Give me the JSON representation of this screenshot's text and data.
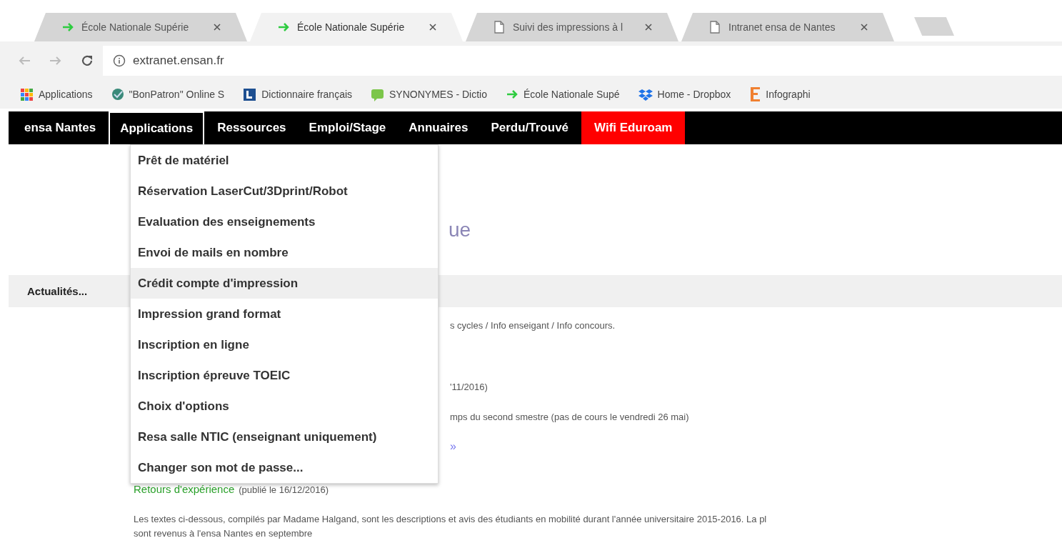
{
  "browser": {
    "tabs": [
      {
        "title": "École Nationale Supérie",
        "kind": "arrow",
        "selected": false
      },
      {
        "title": "École Nationale Supérie",
        "kind": "arrow",
        "selected": true
      },
      {
        "title": "Suivi des impressions à l",
        "kind": "page",
        "selected": false
      },
      {
        "title": "Intranet ensa de Nantes",
        "kind": "page",
        "selected": false
      }
    ],
    "address": "extranet.ensan.fr",
    "bookmarks": [
      {
        "label": "Applications",
        "kind": "grid"
      },
      {
        "label": "\"BonPatron\" Online S",
        "kind": "globe"
      },
      {
        "label": "Dictionnaire français",
        "kind": "book"
      },
      {
        "label": "SYNONYMES - Dictio",
        "kind": "chat"
      },
      {
        "label": "École Nationale Supé",
        "kind": "arrow"
      },
      {
        "label": "Home - Dropbox",
        "kind": "dropbox"
      },
      {
        "label": "Infographi",
        "kind": "e"
      }
    ]
  },
  "nav": {
    "items": [
      {
        "label": "ensa Nantes",
        "kind": "link",
        "selected": false
      },
      {
        "label": "Applications",
        "kind": "link",
        "selected": true
      },
      {
        "label": "Ressources",
        "kind": "link",
        "selected": false
      },
      {
        "label": "Emploi/Stage",
        "kind": "link",
        "selected": false
      },
      {
        "label": "Annuaires",
        "kind": "link",
        "selected": false
      },
      {
        "label": "Perdu/Trouvé",
        "kind": "link",
        "selected": false
      },
      {
        "label": "Wifi Eduroam",
        "kind": "alert",
        "selected": false
      }
    ]
  },
  "menu": {
    "items": [
      {
        "label": "Prêt de matériel",
        "selected": false
      },
      {
        "label": "Réservation LaserCut/3Dprint/Robot",
        "selected": false
      },
      {
        "label": "Evaluation des enseignements",
        "selected": false
      },
      {
        "label": "Envoi de mails en nombre",
        "selected": false
      },
      {
        "label": "Crédit compte d'impression",
        "selected": true
      },
      {
        "label": "Impression grand format",
        "selected": false
      },
      {
        "label": "Inscription en ligne",
        "selected": false
      },
      {
        "label": "Inscription épreuve TOEIC",
        "selected": false
      },
      {
        "label": "Choix d'options",
        "selected": false
      },
      {
        "label": "Resa salle NTIC (enseignant uniquement)",
        "selected": false
      },
      {
        "label": "Changer son mot de passe...",
        "selected": false
      }
    ]
  },
  "content": {
    "heading_fragment": "ue",
    "section_tab": "Actualités...",
    "fragments": [
      {
        "text": "s cycles / Info enseigant / Info concours.",
        "kind": "text"
      },
      {
        "text": "'11/2016)",
        "kind": "text"
      },
      {
        "text": "mps du second smestre (pas de cours le vendredi 26 mai)",
        "kind": "text"
      },
      {
        "text": "»",
        "kind": "link"
      }
    ],
    "article": {
      "title": "Retours d'expérience",
      "meta": "(publié le 16/12/2016)",
      "lines": [
        "Les textes ci-dessous, compilés par Madame Halgand, sont les descriptions et avis des étudiants en mobilité durant l'année universitaire 2015-2016. La pl",
        "sont revenus à l'ensa Nantes en septembre"
      ]
    }
  }
}
